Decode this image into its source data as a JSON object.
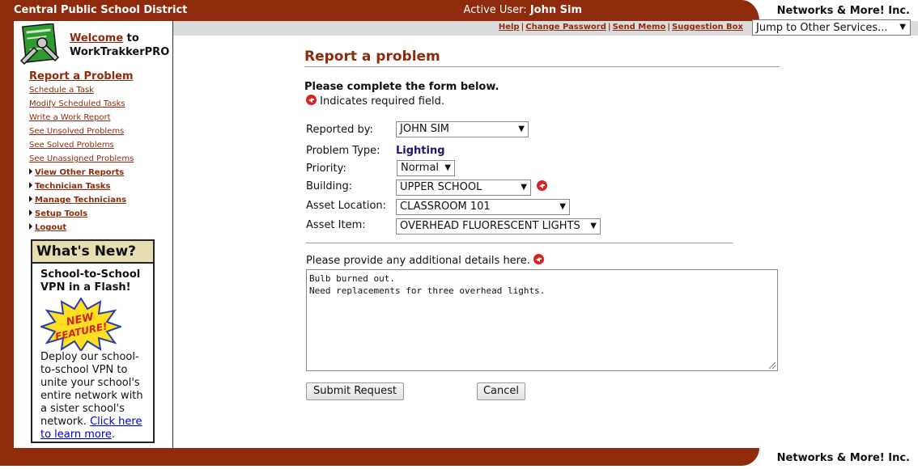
{
  "header": {
    "district": "Central Public School District",
    "active_user_label": "Active User:",
    "active_user_name": "John Sim",
    "company": "Networks & More! Inc."
  },
  "utility": {
    "links": [
      "Help",
      "Change Password",
      "Send Memo",
      "Suggestion Box"
    ],
    "jump_select": "Jump to Other Services..."
  },
  "sidebar": {
    "welcome_link": "Welcome",
    "welcome_to": " to",
    "app_name": "WorkTrakkerPRO",
    "primary": "Report a Problem",
    "sub_items": [
      "Schedule a Task",
      "Modify Scheduled Tasks",
      "Write a Work Report",
      "See Unsolved Problems",
      "See Solved Problems",
      "See Unassigned Problems"
    ],
    "sections": [
      "View Other Reports",
      "Technician Tasks",
      "Manage Technicians",
      "Setup Tools",
      "Logout"
    ]
  },
  "whats_new": {
    "heading": "What's New?",
    "subheading": "School-to-School VPN in a Flash!",
    "badge": "NEW FEATURE!",
    "body": "Deploy our school-to-school VPN to unite your school's entire network with a sister school's network. ",
    "link": "Click here to learn more",
    "period": "."
  },
  "form": {
    "title": "Report a problem",
    "intro": "Please complete the form below.",
    "required_note": "Indicates required field.",
    "reported_by_label": "Reported by:",
    "reported_by_value": "JOHN SIM",
    "problem_type_label": "Problem Type:",
    "problem_type_value": "Lighting",
    "priority_label": "Priority:",
    "priority_value": "Normal",
    "building_label": "Building:",
    "building_value": "UPPER SCHOOL",
    "asset_location_label": "Asset Location:",
    "asset_location_value": "CLASSROOM 101",
    "asset_item_label": "Asset Item:",
    "asset_item_value": "OVERHEAD FLUORESCENT LIGHTS",
    "details_label": "Please provide any additional details here.",
    "details_value": "Bulb burned out.\nNeed replacements for three overhead lights.",
    "submit_label": "Submit Request",
    "cancel_label": "Cancel"
  },
  "colors": {
    "brand": "#8e2b0c",
    "whats_new_header": "#e6ddb3",
    "utility_bar": "#dcdcdc",
    "required": "#e02020"
  }
}
